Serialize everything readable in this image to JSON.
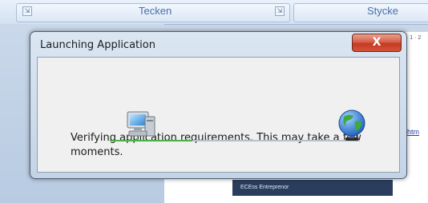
{
  "background": {
    "ribbon_groups": [
      "Tecken",
      "Stycke"
    ],
    "link_text": "htm",
    "banner_text": "ECEss Entreprenor",
    "ruler_text": "· 1 · 2"
  },
  "dialog": {
    "title": "Launching Application",
    "close_label": "X",
    "message": "Verifying application requirements. This may take a few moments.",
    "progress": 0.33,
    "icons": [
      "computer-icon",
      "globe-icon"
    ],
    "accent_color": "#49b04a"
  }
}
